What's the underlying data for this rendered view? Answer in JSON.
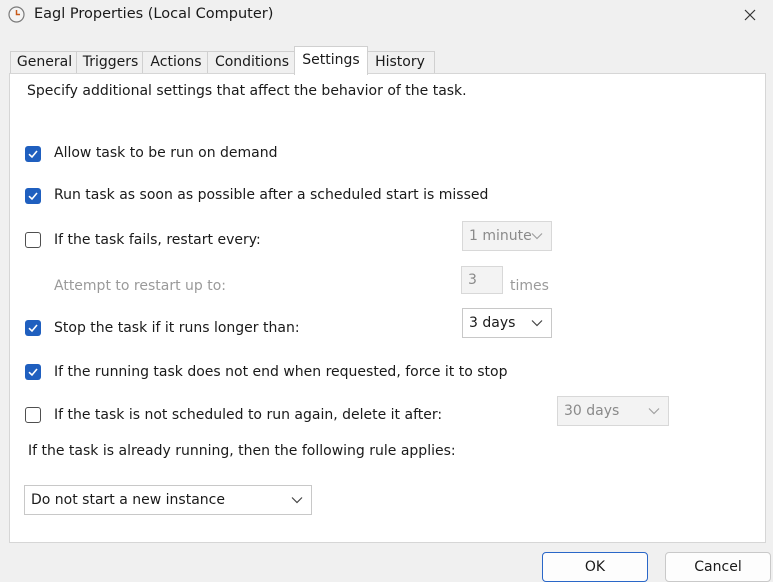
{
  "window": {
    "title": "Eagl Properties (Local Computer)",
    "icon": "clock-icon"
  },
  "tabs": [
    {
      "label": "General",
      "active": false
    },
    {
      "label": "Triggers",
      "active": false
    },
    {
      "label": "Actions",
      "active": false
    },
    {
      "label": "Conditions",
      "active": false
    },
    {
      "label": "Settings",
      "active": true
    },
    {
      "label": "History",
      "active": false
    }
  ],
  "settings": {
    "intro": "Specify additional settings that affect the behavior of the task.",
    "allow_on_demand": {
      "label": "Allow task to be run on demand",
      "checked": true
    },
    "run_asap": {
      "label": "Run task as soon as possible after a scheduled start is missed",
      "checked": true
    },
    "restart_on_fail": {
      "label": "If the task fails, restart every:",
      "checked": false,
      "value": "1 minute"
    },
    "restart_attempts": {
      "label": "Attempt to restart up to:",
      "value": "3",
      "unit": "times"
    },
    "stop_if_long": {
      "label": "Stop the task if it runs longer than:",
      "checked": true,
      "value": "3 days"
    },
    "force_stop": {
      "label": "If the running task does not end when requested, force it to stop",
      "checked": true
    },
    "delete_after": {
      "label": "If the task is not scheduled to run again, delete it after:",
      "checked": false,
      "value": "30 days"
    },
    "running_rule_label": "If the task is already running, then the following rule applies:",
    "running_rule_value": "Do not start a new instance"
  },
  "buttons": {
    "ok": "OK",
    "cancel": "Cancel"
  },
  "colors": {
    "checkbox_accent": "#1f5fbf",
    "default_button_border": "#2a67c8"
  }
}
